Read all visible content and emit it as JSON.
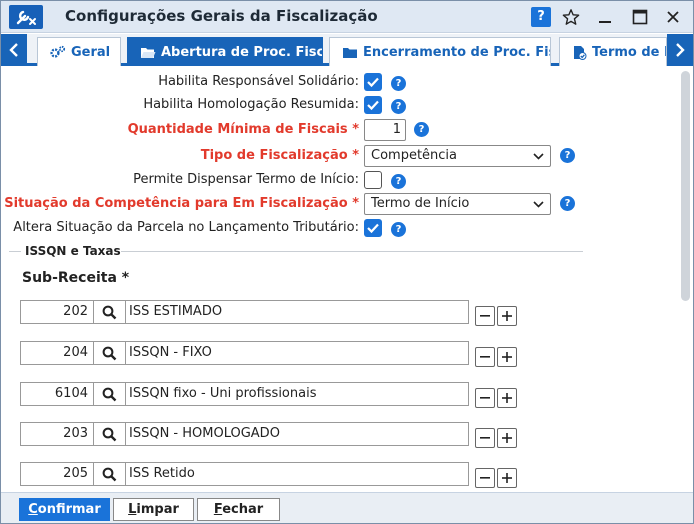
{
  "window": {
    "title": "Configurações Gerais da Fiscalização",
    "help_label": "?"
  },
  "tabs": [
    {
      "label": "Geral",
      "icon": "gears-icon"
    },
    {
      "label": "Abertura de Proc. Fiscal",
      "icon": "folder-open-icon",
      "active": true
    },
    {
      "label": "Encerramento de Proc. Fiscal",
      "icon": "folder-icon"
    },
    {
      "label": "Termo de Início",
      "icon": "document-check-icon"
    }
  ],
  "fields": [
    {
      "label": "Habilita Responsável Solidário:",
      "type": "checkbox",
      "checked": true,
      "required": false
    },
    {
      "label": "Habilita Homologação Resumida:",
      "type": "checkbox",
      "checked": true,
      "required": false
    },
    {
      "label": "Quantidade Mínima de Fiscais *",
      "type": "number",
      "value": "1",
      "required": true
    },
    {
      "label": "Tipo de Fiscalização *",
      "type": "select",
      "value": "Competência",
      "required": true
    },
    {
      "label": "Permite Dispensar Termo de Início:",
      "type": "checkbox",
      "checked": false,
      "required": false
    },
    {
      "label": "Altera Situação da Competência para Em Fiscalização *",
      "type": "select",
      "value": "Termo de Início",
      "required": true
    },
    {
      "label": "Altera Situação da Parcela no Lançamento Tributário:",
      "type": "checkbox",
      "checked": true,
      "required": false
    }
  ],
  "section": {
    "title": "ISSQN e Taxas",
    "subtitle": "Sub-Receita *"
  },
  "subreceitas": [
    {
      "code": "202",
      "name": "ISS ESTIMADO"
    },
    {
      "code": "204",
      "name": "ISSQN - FIXO"
    },
    {
      "code": "6104",
      "name": "ISSQN fixo - Uni profissionais"
    },
    {
      "code": "203",
      "name": "ISSQN - HOMOLOGADO"
    },
    {
      "code": "205",
      "name": "ISS Retido"
    }
  ],
  "footer": {
    "confirm": {
      "accel": "C",
      "rest": "onfirmar"
    },
    "clear": {
      "accel": "L",
      "rest": "impar"
    },
    "close": {
      "accel": "F",
      "rest": "echar"
    }
  },
  "colors": {
    "accent": "#1864b8",
    "required": "#e23a2c",
    "checkbox": "#1a73d9"
  }
}
